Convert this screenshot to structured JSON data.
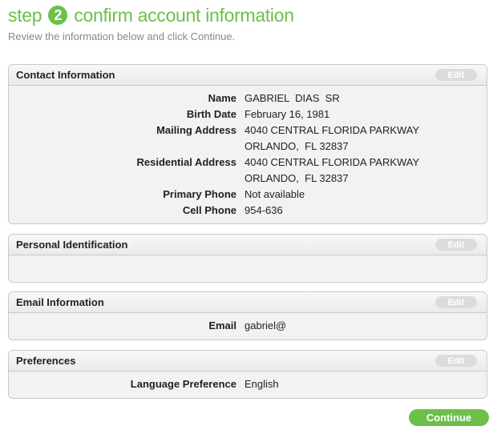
{
  "header": {
    "step_word": "step",
    "step_number": "2",
    "title": "confirm account information",
    "subtitle": "Review the information below and click Continue."
  },
  "colors": {
    "accent": "#6cc04a",
    "edit_bg": "#dcdcdc"
  },
  "edit_label": "Edit",
  "contact": {
    "title": "Contact Information",
    "rows": [
      {
        "label": "Name",
        "value": "GABRIEL  DIAS  SR"
      },
      {
        "label": "Birth Date",
        "value": "February 16, 1981"
      },
      {
        "label": "Mailing Address",
        "value": "4040 CENTRAL FLORIDA PARKWAY"
      },
      {
        "label": "",
        "value": "ORLANDO,  FL 32837"
      },
      {
        "label": "Residential Address",
        "value": "4040 CENTRAL FLORIDA PARKWAY"
      },
      {
        "label": "",
        "value": "ORLANDO,  FL 32837"
      },
      {
        "label": "Primary Phone",
        "value": "Not available"
      },
      {
        "label": "Cell Phone",
        "value": "954-636"
      }
    ]
  },
  "personal": {
    "title": "Personal Identification"
  },
  "email": {
    "title": "Email Information",
    "rows": [
      {
        "label": "Email",
        "value": "gabriel@"
      }
    ]
  },
  "preferences": {
    "title": "Preferences",
    "rows": [
      {
        "label": "Language Preference",
        "value": "English"
      }
    ]
  },
  "continue_label": "Continue"
}
